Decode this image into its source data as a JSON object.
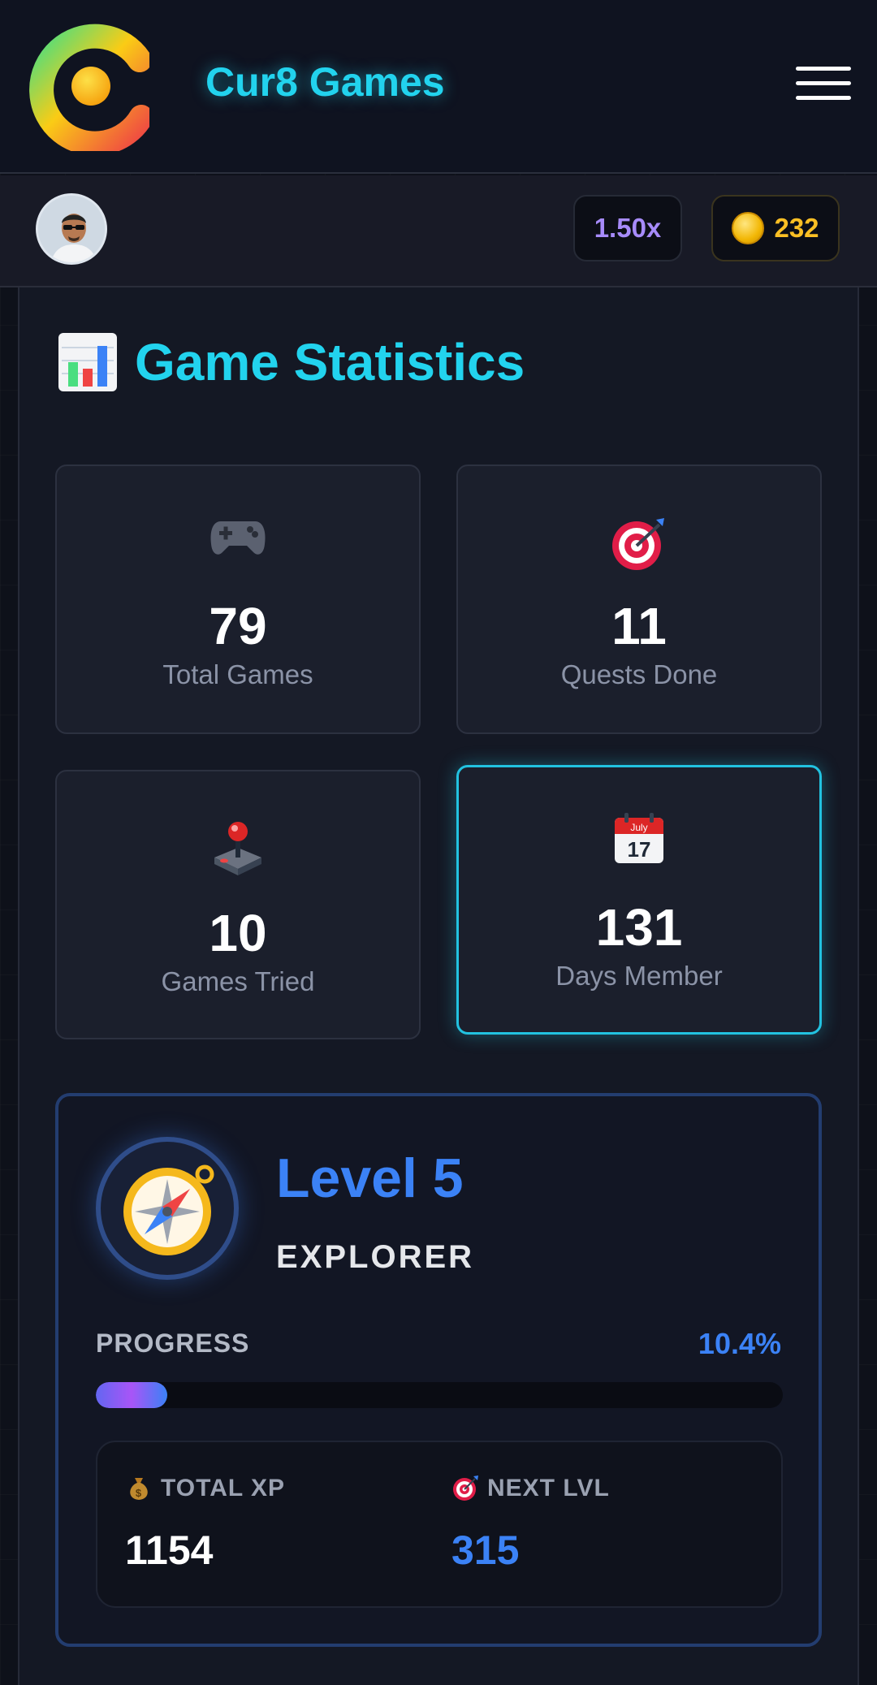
{
  "header": {
    "brand": "Cur8 Games",
    "menu_icon": "hamburger-icon"
  },
  "userbar": {
    "multiplier": "1.50x",
    "coins": "232",
    "coin_icon": "coin-icon"
  },
  "stats": {
    "title": "Game Statistics",
    "title_icon": "bar-chart-icon",
    "cards": [
      {
        "icon": "gamepad-icon",
        "value": "79",
        "label": "Total Games"
      },
      {
        "icon": "target-icon",
        "value": "11",
        "label": "Quests Done"
      },
      {
        "icon": "joystick-icon",
        "value": "10",
        "label": "Games Tried"
      },
      {
        "icon": "calendar-icon",
        "value": "131",
        "label": "Days Member",
        "calendar_month": "July",
        "calendar_day": "17"
      }
    ]
  },
  "level": {
    "title": "Level 5",
    "rank": "EXPLORER",
    "progress_label": "PROGRESS",
    "progress_pct_text": "10.4%",
    "progress_fraction": 0.104,
    "total_xp_label": "TOTAL XP",
    "total_xp": "1154",
    "next_lvl_label": "NEXT LVL",
    "next_lvl": "315"
  },
  "colors": {
    "accent_cyan": "#22d3ee",
    "accent_blue": "#3b82f6",
    "multiplier": "#a78bfa",
    "coins": "#fbbf24"
  }
}
